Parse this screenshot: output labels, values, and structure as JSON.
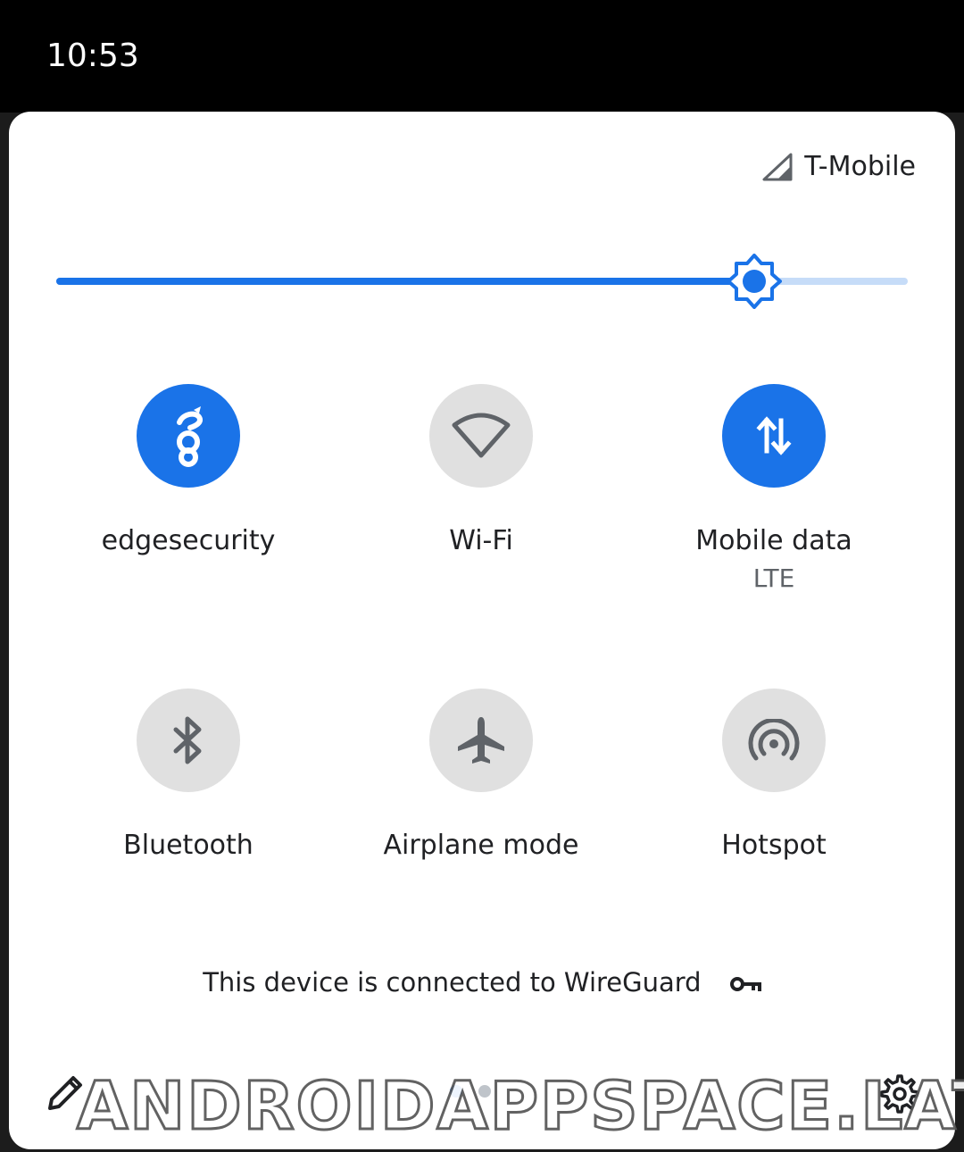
{
  "status_bar": {
    "time": "10:53"
  },
  "panel": {
    "carrier": {
      "name": "T-Mobile",
      "icon": "signal-icon"
    },
    "brightness": {
      "level": 0.82,
      "icon": "brightness-icon",
      "fill_color": "#1a73e8",
      "track_color": "#c6dcf8"
    },
    "tiles": [
      {
        "label": "edgesecurity",
        "sub": "",
        "state": "on",
        "icon": "wireguard-icon"
      },
      {
        "label": "Wi-Fi",
        "sub": "",
        "state": "off",
        "icon": "wifi-icon"
      },
      {
        "label": "Mobile data",
        "sub": "LTE",
        "state": "on",
        "icon": "mobile-data-icon"
      },
      {
        "label": "Bluetooth",
        "sub": "",
        "state": "off",
        "icon": "bluetooth-icon"
      },
      {
        "label": "Airplane mode",
        "sub": "",
        "state": "off",
        "icon": "airplane-icon"
      },
      {
        "label": "Hotspot",
        "sub": "",
        "state": "off",
        "icon": "hotspot-icon"
      }
    ],
    "vpn_message": "This device is connected to WireGuard",
    "footer": {
      "edit_icon": "pencil-icon",
      "settings_icon": "gear-icon",
      "page_count": 2,
      "active_page": 1
    }
  },
  "watermark": "ANDROIDAPPSPACE.LAT",
  "colors": {
    "accent": "#1a73e8",
    "tile_off": "#e0e0e0",
    "panel_bg": "#ffffff",
    "icon_off": "#5f6368"
  }
}
